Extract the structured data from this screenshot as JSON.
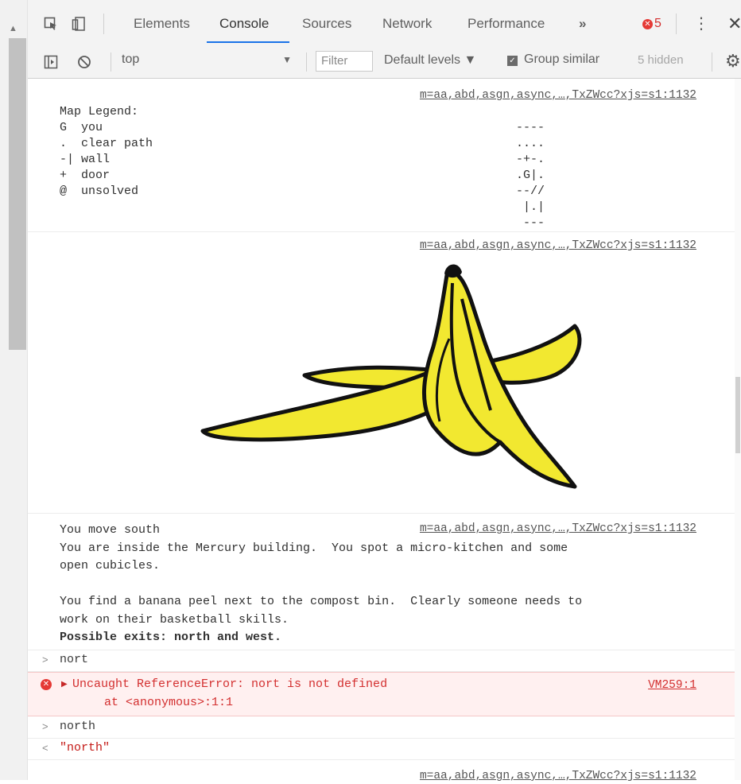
{
  "devtools": {
    "tabs": [
      "Elements",
      "Console",
      "Sources",
      "Network",
      "Performance"
    ],
    "more_tabs_icon": "chevron-double-right",
    "error_count": "5",
    "active_tab": "Console"
  },
  "console_toolbar": {
    "context": "top",
    "filter_placeholder": "Filter",
    "levels": "Default levels ▼",
    "group_similar": "Group similar",
    "hidden_count": "5 hidden"
  },
  "messages": {
    "source": "m=aa,abd,asgn,async,…,TxZWcc?xjs=s1:1132",
    "legend": {
      "text": "Map Legend:\nG  you\n.  clear path\n-| wall\n+  door\n@  unsolved",
      "map": "----\n....\n-+-.\n.G|.\n--//\n |.|\n ---"
    },
    "banana_image": "banana-peel",
    "narrative": {
      "line1": "You move south",
      "line2": "You are inside the Mercury building.  You spot a micro-kitchen and some",
      "line3": "open cubicles.",
      "line4": "You find a banana peel next to the compost bin.  Clearly someone needs to",
      "line5": "work on their basketball skills.",
      "line6": "Possible exits: north and west."
    },
    "cmd1": "nort",
    "error": {
      "message": "Uncaught ReferenceError: nort is not defined",
      "stack": "at <anonymous>:1:1",
      "source": "VM259:1"
    },
    "cmd2": "north",
    "result2": "\"north\"",
    "last_source": "m=aa,abd,asgn,async,…,TxZWcc?xjs=s1:1132"
  },
  "colors": {
    "banana_fill": "#f2e830",
    "banana_outline": "#111111",
    "error_red": "#d32f2f",
    "tab_underline": "#1a73e8"
  }
}
